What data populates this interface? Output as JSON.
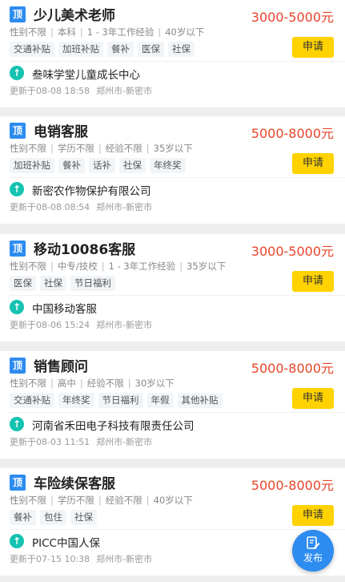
{
  "jobs": [
    {
      "badge": "顶",
      "title": "少儿美术老师",
      "salary": "3000-5000元",
      "requirements": [
        "性别不限",
        "本科",
        "1 - 3年工作经验",
        "40岁以下"
      ],
      "tags": [
        "交通补贴",
        "加班补贴",
        "餐补",
        "医保",
        "社保"
      ],
      "apply_label": "申请",
      "company": "叁味学堂儿童成长中心",
      "updated": "更新于08-08 18:58",
      "location": "郑州市-新密市"
    },
    {
      "badge": "顶",
      "title": "电销客服",
      "salary": "5000-8000元",
      "requirements": [
        "性别不限",
        "学历不限",
        "经验不限",
        "35岁以下"
      ],
      "tags": [
        "加班补贴",
        "餐补",
        "话补",
        "社保",
        "年终奖"
      ],
      "apply_label": "申请",
      "company": "新密农作物保护有限公司",
      "updated": "更新于08-08 08:54",
      "location": "郑州市-新密市"
    },
    {
      "badge": "顶",
      "title": "移动10086客服",
      "salary": "3000-5000元",
      "requirements": [
        "性别不限",
        "中专/技校",
        "1 - 3年工作经验",
        "35岁以下"
      ],
      "tags": [
        "医保",
        "社保",
        "节日福利"
      ],
      "apply_label": "申请",
      "company": "中国移动客服",
      "updated": "更新于08-06 15:24",
      "location": "郑州市-新密市"
    },
    {
      "badge": "顶",
      "title": "销售顾问",
      "salary": "5000-8000元",
      "requirements": [
        "性别不限",
        "高中",
        "经验不限",
        "30岁以下"
      ],
      "tags": [
        "交通补贴",
        "年终奖",
        "节日福利",
        "年假",
        "其他补贴"
      ],
      "apply_label": "申请",
      "company": "河南省禾田电子科技有限责任公司",
      "updated": "更新于08-03 11:51",
      "location": "郑州市-新密市"
    },
    {
      "badge": "顶",
      "title": "车险续保客服",
      "salary": "5000-8000元",
      "requirements": [
        "性别不限",
        "学历不限",
        "经验不限",
        "40岁以下"
      ],
      "tags": [
        "餐补",
        "包住",
        "社保"
      ],
      "apply_label": "申请",
      "company": "PICC中国人保",
      "updated": "更新于07-15 10:38",
      "location": "郑州市-新密市"
    }
  ],
  "fab": {
    "label": "发布",
    "icon": "edit-icon"
  },
  "colors": {
    "accent_blue": "#2d8cf0",
    "salary_red": "#e8452a",
    "apply_yellow": "#ffd200",
    "company_teal": "#14c3b0"
  }
}
